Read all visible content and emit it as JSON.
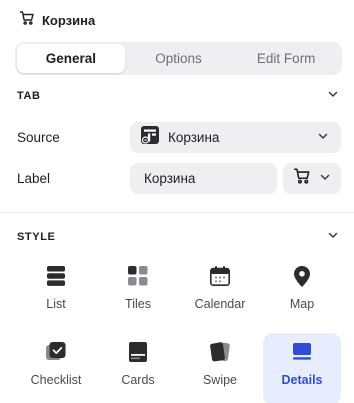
{
  "header": {
    "title": "Корзина",
    "icon": "cart-icon"
  },
  "tabs": [
    {
      "label": "General",
      "active": true
    },
    {
      "label": "Options",
      "active": false
    },
    {
      "label": "Edit Form",
      "active": false
    }
  ],
  "tab_section": {
    "title": "TAB",
    "source_label": "Source",
    "source_value": "Корзина",
    "source_icon": "table-source-icon",
    "label_label": "Label",
    "label_value": "Корзина",
    "label_icon": "cart-icon"
  },
  "style_section": {
    "title": "STYLE",
    "options": [
      {
        "label": "List",
        "icon": "list-icon",
        "active": false
      },
      {
        "label": "Tiles",
        "icon": "tiles-icon",
        "active": false
      },
      {
        "label": "Calendar",
        "icon": "calendar-icon",
        "active": false
      },
      {
        "label": "Map",
        "icon": "map-pin-icon",
        "active": false
      },
      {
        "label": "Checklist",
        "icon": "checklist-icon",
        "active": false
      },
      {
        "label": "Cards",
        "icon": "cards-icon",
        "active": false
      },
      {
        "label": "Swipe",
        "icon": "swipe-icon",
        "active": false
      },
      {
        "label": "Details",
        "icon": "details-icon",
        "active": true
      }
    ]
  },
  "colors": {
    "accent": "#2f4bd9",
    "accent_bg": "#e8edfd",
    "field_bg": "#efeff1"
  }
}
